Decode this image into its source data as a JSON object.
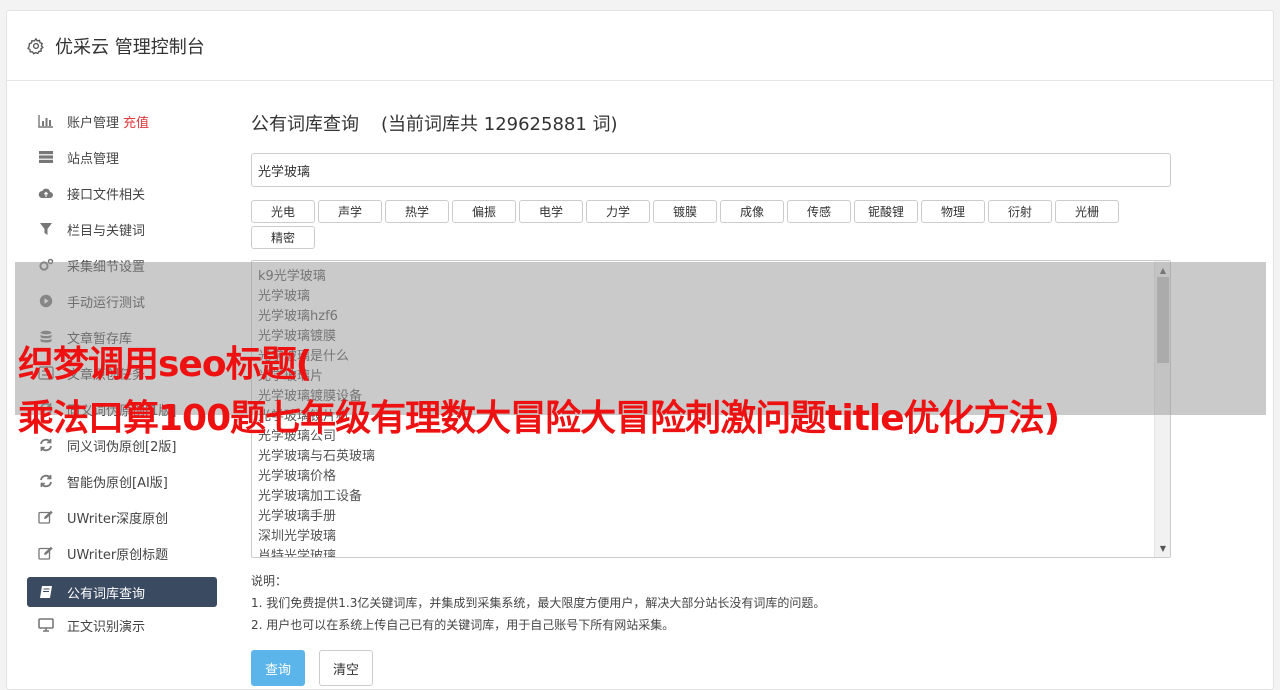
{
  "header": {
    "title": "优采云 管理控制台"
  },
  "sidebar": {
    "items": [
      {
        "label": "账户管理",
        "extra": "充值",
        "icon": "bar-chart-icon"
      },
      {
        "label": "站点管理",
        "icon": "server-icon"
      },
      {
        "label": "接口文件相关",
        "icon": "cloud-upload-icon"
      },
      {
        "label": "栏目与关键词",
        "icon": "filter-icon"
      },
      {
        "label": "采集细节设置",
        "icon": "cogs-icon"
      },
      {
        "label": "手动运行测试",
        "icon": "play-circle-icon"
      },
      {
        "label": "文章暂存库",
        "icon": "database-icon"
      },
      {
        "label": "文章原创任务",
        "icon": "tasks-icon"
      },
      {
        "label": "同义词伪原创[1版]",
        "icon": "refresh-icon"
      },
      {
        "label": "同义词伪原创[2版]",
        "icon": "refresh-icon"
      },
      {
        "label": "智能伪原创[AI版]",
        "icon": "refresh-icon"
      },
      {
        "label": "UWriter深度原创",
        "icon": "edit-icon"
      },
      {
        "label": "UWriter原创标题",
        "icon": "edit-icon"
      },
      {
        "label": "公有词库查询",
        "icon": "book-icon",
        "active": true
      },
      {
        "label": "正文识别演示",
        "icon": "monitor-icon"
      }
    ]
  },
  "main": {
    "title": "公有词库查询",
    "count_text": "(当前词库共 129625881 词)",
    "search_value": "光学玻璃",
    "tags": [
      "光电",
      "声学",
      "热学",
      "偏振",
      "电学",
      "力学",
      "镀膜",
      "成像",
      "传感",
      "铌酸锂",
      "物理",
      "衍射",
      "光栅",
      "精密"
    ],
    "results": [
      "k9光学玻璃",
      "光学玻璃",
      "光学玻璃hzf6",
      "光学玻璃镀膜",
      "光学玻璃是什么",
      "光学玻璃片",
      "光学玻璃镀膜设备",
      "光学玻璃镜片机",
      "光学玻璃公司",
      "光学玻璃与石英玻璃",
      "光学玻璃价格",
      "光学玻璃加工设备",
      "光学玻璃手册",
      "深圳光学玻璃",
      "肖特光学玻璃"
    ],
    "notes": {
      "heading": "说明：",
      "line1": "1. 我们免费提供1.3亿关键词库，并集成到采集系统，最大限度方便用户，解决大部分站长没有词库的问题。",
      "line2": "2. 用户也可以在系统上传自己已有的关键词库，用于自己账号下所有网站采集。"
    },
    "query_button": "查询",
    "clear_button": "清空"
  },
  "overlay": {
    "line1": "织梦调用seo标题(",
    "line2": "乘法口算100题七年级有理数大冒险大冒险刺激问题title优化方法)"
  },
  "colors": {
    "accent": "#5bb4ea",
    "active_nav": "#3a4a60",
    "overlay_text": "#ee1111",
    "recharge": "#e4393c"
  }
}
